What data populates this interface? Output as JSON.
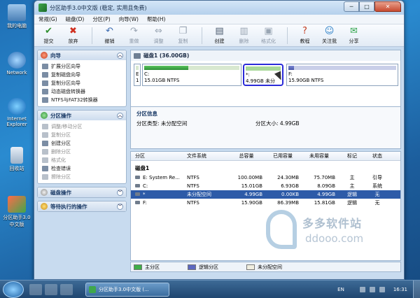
{
  "desktop": {
    "icons": [
      {
        "label": "我的电脑"
      },
      {
        "label": "Network"
      },
      {
        "label": "Internet Explorer"
      },
      {
        "label": "回收站"
      },
      {
        "label": "分区助手3.0中文版"
      }
    ]
  },
  "window": {
    "title": "分区助手3.0中文版 (稳定, 实用且免费)",
    "controls": {
      "minimize": "─",
      "maximize": "□",
      "close": "✕"
    }
  },
  "menu": [
    "常规(G)",
    "磁盘(D)",
    "分区(P)",
    "向导(W)",
    "帮助(H)"
  ],
  "toolbar": [
    {
      "label": "提交",
      "icon": "✔",
      "color": "#2f8f2f",
      "enabled": true
    },
    {
      "label": "放弃",
      "icon": "✖",
      "color": "#d03020",
      "enabled": true
    },
    {
      "label": "撤销",
      "icon": "↶",
      "color": "#3a6ab0",
      "enabled": true
    },
    {
      "label": "重做",
      "icon": "↷",
      "color": "#9aa6b4",
      "enabled": false
    },
    {
      "label": "调整",
      "icon": "⇔",
      "color": "#9aa6b4",
      "enabled": false
    },
    {
      "label": "复制",
      "icon": "❐",
      "color": "#9aa6b4",
      "enabled": false
    },
    {
      "label": "创建",
      "icon": "▤",
      "color": "#4a5a6e",
      "enabled": true
    },
    {
      "label": "删除",
      "icon": "▥",
      "color": "#9aa6b4",
      "enabled": false
    },
    {
      "label": "格式化",
      "icon": "▣",
      "color": "#9aa6b4",
      "enabled": false
    },
    {
      "label": "教程",
      "icon": "?",
      "color": "#c23a1e",
      "enabled": true
    },
    {
      "label": "关注我",
      "icon": "☺",
      "color": "#2b7fc7",
      "enabled": true
    },
    {
      "label": "分享",
      "icon": "✉",
      "color": "#2fa44a",
      "enabled": true
    }
  ],
  "wizard_panel": {
    "title": "向导",
    "items": [
      "扩展分区向导",
      "复制磁盘向导",
      "复制分区向导",
      "动态磁盘转换器",
      "NTFS与FAT32转换器"
    ]
  },
  "partition_panel": {
    "title": "分区操作",
    "items": [
      {
        "label": "调整/移动分区",
        "enabled": false
      },
      {
        "label": "复制分区",
        "enabled": false
      },
      {
        "label": "创建分区",
        "enabled": true
      },
      {
        "label": "删除分区",
        "enabled": false
      },
      {
        "label": "格式化",
        "enabled": false
      },
      {
        "label": "检查错误",
        "enabled": true
      },
      {
        "label": "擦除分区",
        "enabled": false
      }
    ]
  },
  "disk_ops_panel": {
    "title": "磁盘操作"
  },
  "pending_panel": {
    "title": "等待执行的操作"
  },
  "disk_map": {
    "disk_title": "磁盘1 (36.00GB)",
    "partitions": [
      {
        "label": "E",
        "sub": "1",
        "fill": 0
      },
      {
        "label": "C:",
        "sub": "15.01GB NTFS",
        "fill": 0.46
      },
      {
        "label": "*:",
        "sub": "4.99GB 未分",
        "fill": 0
      },
      {
        "label": "F:",
        "sub": "15.90GB NTFS",
        "fill": 0.05
      }
    ]
  },
  "partition_info": {
    "header": "分区信息",
    "type_label": "分区类型: 未分配空间",
    "size_label": "分区大小: 4.99GB"
  },
  "table": {
    "headers": [
      "分区",
      "文件系统",
      "总容量",
      "已用容量",
      "未用容量",
      "标记",
      "状态"
    ],
    "group": "磁盘1",
    "rows": [
      [
        "E: System Re...",
        "NTFS",
        "100.00MB",
        "24.30MB",
        "75.70MB",
        "主",
        "引导"
      ],
      [
        "C:",
        "NTFS",
        "15.01GB",
        "6.93GB",
        "8.09GB",
        "主",
        "系统"
      ],
      [
        "*",
        "未分配空间",
        "4.99GB",
        "0.00KB",
        "4.99GB",
        "逻辑",
        "无"
      ],
      [
        "F:",
        "NTFS",
        "15.90GB",
        "86.39MB",
        "15.81GB",
        "逻辑",
        "无"
      ]
    ]
  },
  "legend": [
    {
      "label": "主分区",
      "color": "#3fae48"
    },
    {
      "label": "逻辑分区",
      "color": "#5c68c0"
    },
    {
      "label": "未分配空间",
      "color": "#f0eee0"
    }
  ],
  "watermark": {
    "brand": "多多软件站",
    "url": "ddooo.com"
  },
  "taskbar": {
    "task_label": "分区助手3.0中文版 (...",
    "lang": "EN",
    "clock": "16:31"
  }
}
